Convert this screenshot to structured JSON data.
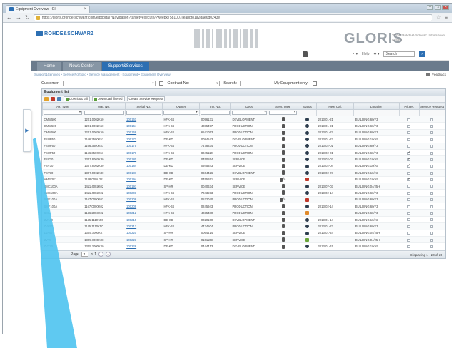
{
  "browser": {
    "tab_title": "Equipment Overview - Gl",
    "url": "https://gloris.grohde-schwarz.com/ejpportal?Navigation?target=execute/?weebk7581007lleabbto1a2dae6d0243e"
  },
  "header": {
    "logo_text": "ROHDE&SCHWARZ",
    "brand": "GLORIS",
    "tagline": "Global Rohde & Schwarz Information System",
    "help_label": "Help",
    "search_value": "Search",
    "go_label": "»"
  },
  "nav": {
    "items": [
      {
        "label": "Home"
      },
      {
        "label": "News Center"
      },
      {
        "label": "Support&Services"
      }
    ]
  },
  "breadcrumb": {
    "path": "Support&Services • Service Portfolio • Service Management • Equipment • Equipment Overview",
    "feedback": "Feedback"
  },
  "filters": {
    "customer_label": "Customer:",
    "contract_label": "Contract No:",
    "search_label": "Search:",
    "my_equipment_label": "My Equipment only:"
  },
  "panel": {
    "title": "Equipment list",
    "btn_download": "Download all",
    "btn_download_filtered": "Download filtered",
    "btn_service_request": "Create Service Request"
  },
  "table": {
    "columns": [
      "Ax. Type",
      "Mat. No.",
      "Serial No.",
      "Owner",
      "Inv. No.",
      "Dept.",
      "Serv. Type",
      "Status",
      "Next Cal.",
      "Location",
      "Pri.Re.",
      "Service Request"
    ],
    "rows": [
      {
        "type": "CMW500",
        "mat": "1201.0002K50",
        "serial": "100161",
        "owner": "HFK-34",
        "inv": "0096131",
        "dept": "DEVELOPMENT",
        "status": "dark",
        "next": "2013-01-21",
        "loc": "BUILDING 60/F3",
        "pri": false
      },
      {
        "type": "CMW500",
        "mat": "1201.0002K50",
        "serial": "100164",
        "owner": "HFK-34",
        "inv": "4085497",
        "dept": "PRODUCTION",
        "status": "dark",
        "next": "2013-01-21",
        "loc": "BUILDING 60/F3",
        "pri": false
      },
      {
        "type": "CMW500",
        "mat": "1201.0002K50",
        "serial": "100166",
        "owner": "HFK-34",
        "inv": "6541053",
        "dept": "PRODUCTION",
        "status": "dark",
        "next": "2013-01-27",
        "loc": "BUILDING 60/F3",
        "pri": false
      },
      {
        "type": "FSUP50",
        "mat": "1166.3500K51",
        "serial": "100171",
        "owner": "DE-KD",
        "inv": "0084543",
        "dept": "DEVELOPMENT",
        "status": "dark",
        "next": "2013-01-22",
        "loc": "BUILDING 10/A5",
        "pri": false
      },
      {
        "type": "FSUP50",
        "mat": "1166.3500K51",
        "serial": "100175",
        "owner": "HFK-34",
        "inv": "7478834",
        "dept": "PRODUCTION",
        "status": "dark",
        "next": "2013-02-01",
        "loc": "BUILDING 60/F3",
        "pri": false
      },
      {
        "type": "FSUP50",
        "mat": "1166.3500K51",
        "serial": "100176",
        "owner": "HFK-34",
        "inv": "8045110",
        "dept": "PRODUCTION",
        "status": "dark",
        "next": "2013-02-01",
        "loc": "BUILDING 60/F3",
        "pri": true
      },
      {
        "type": "FSV30",
        "mat": "1307.9002K30",
        "serial": "100180",
        "owner": "DE-KD",
        "inv": "0450554",
        "dept": "SERVICE",
        "status": "dark",
        "next": "2013-02-03",
        "loc": "BUILDING 10/A5",
        "pri": true
      },
      {
        "type": "FSV30",
        "mat": "1307.9002K30",
        "serial": "100184",
        "owner": "DE-KD",
        "inv": "0945343",
        "dept": "SERVICE",
        "status": "dark",
        "next": "2013-02-04",
        "loc": "BUILDING 10/A5",
        "pri": true
      },
      {
        "type": "FSV30",
        "mat": "1307.9002K30",
        "serial": "100187",
        "owner": "DE-KD",
        "inv": "0604426",
        "dept": "DEVELOPMENT",
        "status": "dark",
        "next": "2013-02-07",
        "loc": "BUILDING 10/A5",
        "pri": false
      },
      {
        "type": "HMP 2E1",
        "mat": "1188.0008.22",
        "serial": "100194",
        "owner": "DE-KD",
        "inv": "0455651",
        "dept": "SERVICE",
        "status": "red",
        "next": "",
        "loc": "BUILDING 10/A5",
        "pri": true
      },
      {
        "type": "SMC100A",
        "mat": "1411.4002K02",
        "serial": "100197",
        "owner": "SP-HR",
        "inv": "0040634",
        "dept": "SERVICE",
        "status": "dark",
        "next": "2013-0?-03",
        "loc": "BUILDING 04/25H",
        "pri": false
      },
      {
        "type": "SMC100A",
        "mat": "1411.4002K02",
        "serial": "100201",
        "owner": "HFK-34",
        "inv": "7043593",
        "dept": "PRODUCTION",
        "status": "dark",
        "next": "2013-02-14",
        "loc": "BUILDING 60/F3",
        "pri": false
      },
      {
        "type": "SMF100A",
        "mat": "1167.0000K02",
        "serial": "100206",
        "owner": "HFK-34",
        "inv": "0522040",
        "dept": "PRODUCTION",
        "status": "red",
        "next": "",
        "loc": "BUILDING 60/F3",
        "pri": false
      },
      {
        "type": "SMF100A",
        "mat": "1167.0000K02",
        "serial": "100209",
        "owner": "HFK-34",
        "inv": "0245943",
        "dept": "PRODUCTION",
        "status": "dark",
        "next": "2013-02-14",
        "loc": "BUILDING 60/F3",
        "pri": false
      },
      {
        "type": "SMU",
        "mat": "1146.2003K02",
        "serial": "100212",
        "owner": "HFK-34",
        "inv": "4035480",
        "dept": "PRODUCTION",
        "status": "orange",
        "next": "",
        "loc": "BUILDING 60/F3",
        "pri": false
      },
      {
        "type": "ZVA40",
        "mat": "1145.1110K50",
        "serial": "100215",
        "owner": "DE-KD",
        "inv": "0020100",
        "dept": "DEVELOPMENT",
        "status": "dark",
        "next": "2013-01-14",
        "loc": "BUILDING 10/A5",
        "pri": false
      },
      {
        "type": "ZVA50",
        "mat": "1145.1110K50",
        "serial": "100217",
        "owner": "HFK-34",
        "inv": "4434504",
        "dept": "PRODUCTION",
        "status": "dark",
        "next": "2013-01-23",
        "loc": "BUILDING 60/F3",
        "pri": false
      },
      {
        "type": "ZVA67",
        "mat": "1305.7000K07",
        "serial": "100220",
        "owner": "SP-HR",
        "inv": "0064414",
        "dept": "SERVICE",
        "status": "dark",
        "next": "2013-01-24",
        "loc": "BUILDING 04/25H",
        "pri": false
      },
      {
        "type": "ZVT8",
        "mat": "1305.7000K08",
        "serial": "100223",
        "owner": "SP-HR",
        "inv": "0101103",
        "dept": "SERVICE",
        "status": "green",
        "next": "",
        "loc": "BUILDING 04/25H",
        "pri": false
      },
      {
        "type": "ZVT20",
        "mat": "1305.7000K20",
        "serial": "100226",
        "owner": "DE-KD",
        "inv": "0444413",
        "dept": "DEVELOPMENT",
        "status": "dark",
        "next": "2013-01-15",
        "loc": "BUILDING 10/A5",
        "pri": false
      }
    ]
  },
  "pager": {
    "page_label": "Page",
    "page_value": "1",
    "of_label": "of 1",
    "displaying": "Displaying 1 - 20 of 20"
  },
  "colors": {
    "brand_blue": "#2c6fb3",
    "nav_bar": "#6b7b8c",
    "pointer": "#4ec3f0"
  },
  "icons": {
    "service_type": "document-icon",
    "status": "status-icon",
    "edit": "pencil-icon"
  }
}
